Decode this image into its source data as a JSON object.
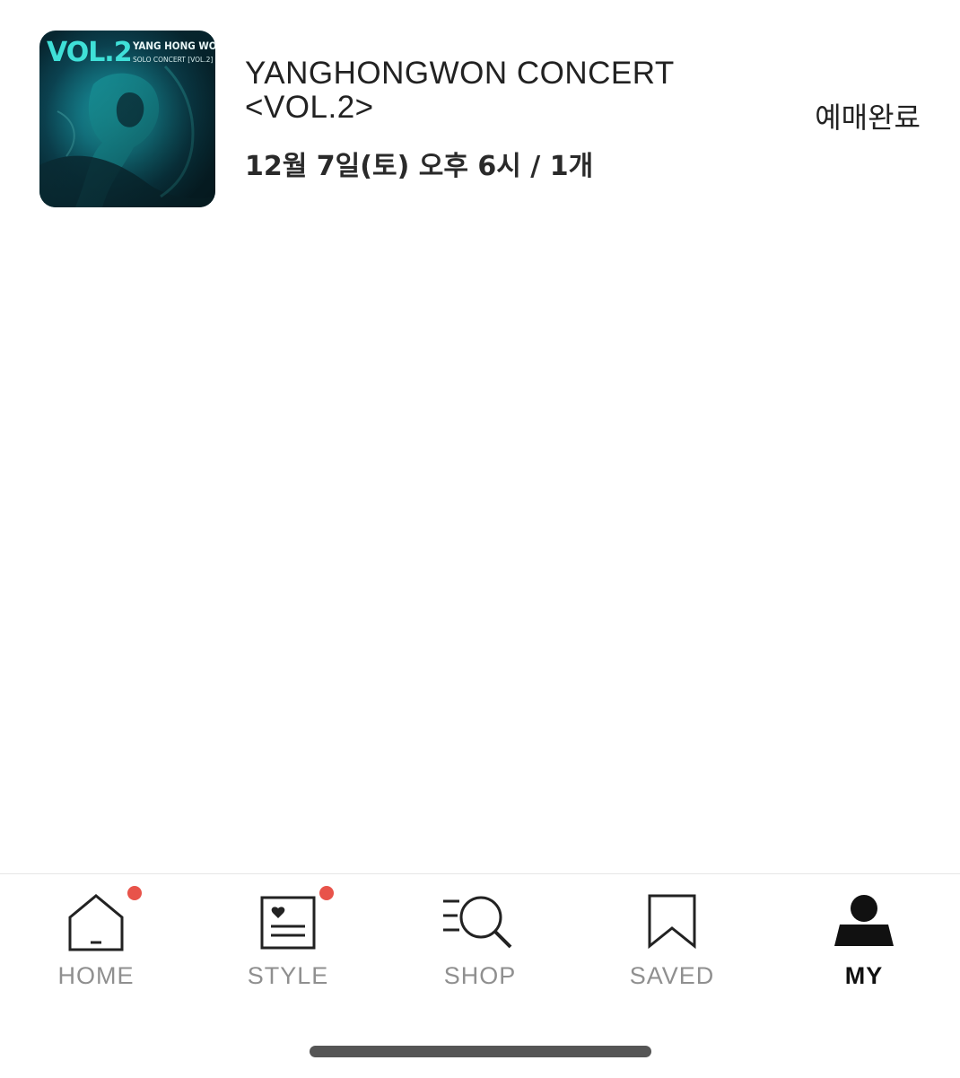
{
  "order": {
    "poster": {
      "vol_text": "VOL.2",
      "artist_text": "YANG HONG WON",
      "sub_text": "SOLO CONCERT [VOL.2]"
    },
    "title": "YANGHONGWON CONCERT\n<VOL.2>",
    "datetime": "12월 7일(토) 오후 6시 / 1개",
    "status": "예매완료"
  },
  "tabbar": {
    "items": [
      {
        "label": "HOME",
        "icon": "home-icon",
        "badge": true,
        "active": false
      },
      {
        "label": "STYLE",
        "icon": "style-icon",
        "badge": true,
        "active": false
      },
      {
        "label": "SHOP",
        "icon": "shop-search-icon",
        "badge": false,
        "active": false
      },
      {
        "label": "SAVED",
        "icon": "bookmark-icon",
        "badge": false,
        "active": false
      },
      {
        "label": "MY",
        "icon": "profile-icon",
        "badge": false,
        "active": true
      }
    ]
  },
  "colors": {
    "badge": "#e8534a",
    "active": "#111111",
    "inactive": "#8f8f8f",
    "poster_accent": "#39d6d0"
  }
}
